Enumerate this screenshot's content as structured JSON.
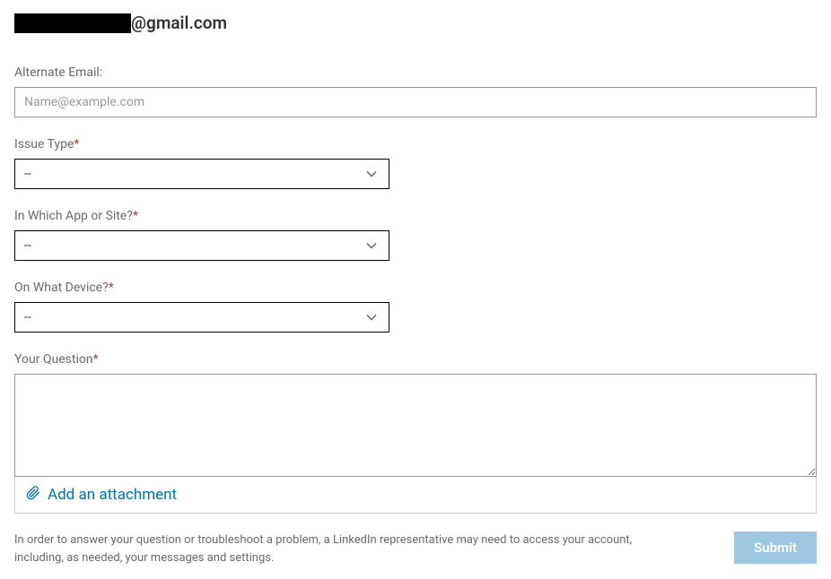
{
  "email": {
    "suffix": "@gmail.com"
  },
  "form": {
    "alternate_email": {
      "label": "Alternate Email:",
      "placeholder": "Name@example.com",
      "value": ""
    },
    "issue_type": {
      "label": "Issue Type",
      "required": "*",
      "selected": "--"
    },
    "app_or_site": {
      "label": "In Which App or Site?",
      "required": "*",
      "selected": "--"
    },
    "device": {
      "label": "On What Device?",
      "required": "*",
      "selected": "--"
    },
    "question": {
      "label": "Your Question",
      "required": "*",
      "value": ""
    },
    "attachment": {
      "label": "Add an attachment"
    },
    "disclaimer": "In order to answer your question or troubleshoot a problem, a LinkedIn representative may need to access your account, including, as needed, your messages and settings.",
    "submit_label": "Submit"
  }
}
